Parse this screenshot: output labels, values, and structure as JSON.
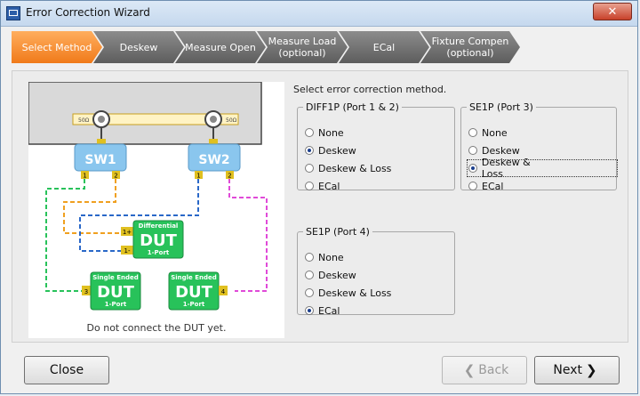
{
  "window": {
    "title": "Error Correction Wizard",
    "close_glyph": "✕"
  },
  "steps": [
    {
      "label": "Select Method",
      "active": true
    },
    {
      "label": "Deskew",
      "active": false
    },
    {
      "label": "Measure Open",
      "active": false
    },
    {
      "label": "Measure Load\n(optional)",
      "active": false
    },
    {
      "label": "ECal",
      "active": false
    },
    {
      "label": "Fixture Compen\n(optional)",
      "active": false
    }
  ],
  "main": {
    "instruction": "Select error correction method."
  },
  "diagram": {
    "port_labels": [
      "50Ω",
      "50Ω"
    ],
    "switches": [
      "SW1",
      "SW2"
    ],
    "pin_labels": [
      "1",
      "2",
      "1",
      "2"
    ],
    "duts": [
      {
        "top": "Differential",
        "main": "DUT",
        "sub": "1-Port",
        "pins": [
          "1+",
          "1-"
        ]
      },
      {
        "top": "Single Ended",
        "main": "DUT",
        "sub": "1-Port",
        "pins": [
          "3"
        ]
      },
      {
        "top": "Single Ended",
        "main": "DUT",
        "sub": "1-Port",
        "pins": [
          "4"
        ]
      }
    ],
    "caption": "Do not connect the DUT yet.",
    "colors": {
      "green": "#28c25a",
      "orange": "#f0a020",
      "blue": "#2a68c8",
      "magenta": "#e04ad8",
      "switch": "#8ac6ee"
    }
  },
  "groups": {
    "diff1p": {
      "legend": "DIFF1P (Port 1 & 2)",
      "options": [
        "None",
        "Deskew",
        "Deskew & Loss",
        "ECal"
      ],
      "selected": 1
    },
    "se1p3": {
      "legend": "SE1P (Port 3)",
      "options": [
        "None",
        "Deskew",
        "Deskew & Loss",
        "ECal"
      ],
      "selected": 2
    },
    "se1p4": {
      "legend": "SE1P (Port 4)",
      "options": [
        "None",
        "Deskew",
        "Deskew & Loss",
        "ECal"
      ],
      "selected": 3
    }
  },
  "footer": {
    "close": "Close",
    "back": "Back",
    "next": "Next",
    "back_glyph": "❮",
    "next_glyph": "❯"
  }
}
